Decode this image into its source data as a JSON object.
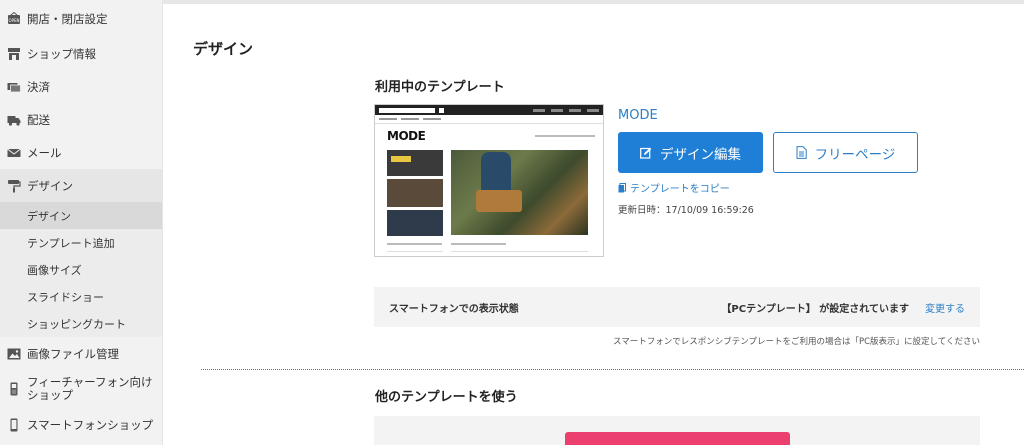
{
  "sidebar": {
    "items": [
      {
        "label": "開店・閉店設定",
        "icon": "open-sign-icon"
      },
      {
        "label": "ショップ情報",
        "icon": "shop-icon"
      },
      {
        "label": "決済",
        "icon": "payment-icon"
      },
      {
        "label": "配送",
        "icon": "truck-icon"
      },
      {
        "label": "メール",
        "icon": "mail-icon"
      },
      {
        "label": "デザイン",
        "icon": "paint-roller-icon"
      }
    ],
    "design_sub": [
      {
        "label": "デザイン"
      },
      {
        "label": "テンプレート追加"
      },
      {
        "label": "画像サイズ"
      },
      {
        "label": "スライドショー"
      },
      {
        "label": "ショッピングカート"
      }
    ],
    "items_after": [
      {
        "label": "画像ファイル管理",
        "icon": "image-icon"
      },
      {
        "label": "フィーチャーフォン向けショップ",
        "icon": "feature-phone-icon"
      },
      {
        "label": "スマートフォンショップ",
        "icon": "smartphone-icon"
      }
    ]
  },
  "main": {
    "title": "デザイン",
    "current_section": "利用中のテンプレート",
    "template": {
      "name": "MODE",
      "thumb_logo": "MODE",
      "edit_label": "デザイン編集",
      "free_page_label": "フリーページ",
      "copy_label": "テンプレートをコピー",
      "updated": "更新日時：17/10/09 16:59:26"
    },
    "smartphone": {
      "label": "スマートフォンでの表示状態",
      "status": "【PCテンプレート】 が設定されています",
      "change_label": "変更する",
      "note": "スマートフォンでレスポンシブテンプレートをご利用の場合は「PC版表示」に設定してください"
    },
    "other_section": "他のテンプレートを使う"
  },
  "colors": {
    "accent": "#1f7fd6",
    "link": "#2b7fc7",
    "pink": "#ea3f6f"
  }
}
